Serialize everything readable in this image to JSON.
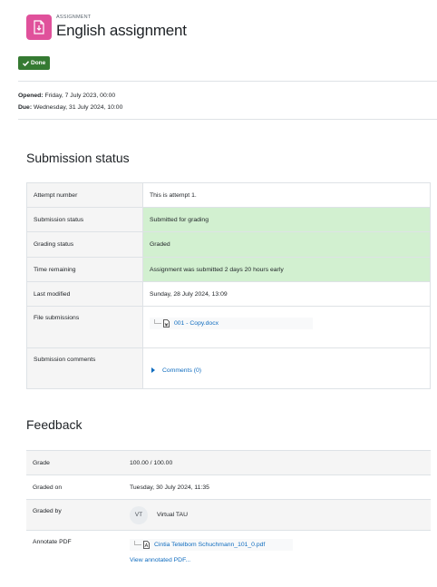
{
  "header": {
    "activity_type": "ASSIGNMENT",
    "title": "English assignment",
    "icon": "assignment-icon",
    "icon_color": "#e0519b"
  },
  "completion": {
    "label": "Done",
    "color": "#357a32"
  },
  "dates": {
    "opened_label": "Opened:",
    "opened_value": "Friday, 7 July 2023, 00:00",
    "due_label": "Due:",
    "due_value": "Wednesday, 31 July 2024, 10:00"
  },
  "submission": {
    "heading": "Submission status",
    "rows": [
      {
        "label": "Attempt number",
        "value": "This is attempt 1."
      },
      {
        "label": "Submission status",
        "value": "Submitted for grading"
      },
      {
        "label": "Grading status",
        "value": "Graded"
      },
      {
        "label": "Time remaining",
        "value": "Assignment was submitted 2 days 20 hours early"
      },
      {
        "label": "Last modified",
        "value": "Sunday, 28 July 2024, 13:09"
      },
      {
        "label": "File submissions",
        "value": "001 - Copy.docx"
      },
      {
        "label": "Submission comments",
        "value": "Comments (0)"
      }
    ],
    "success_color": "#d2f0d0"
  },
  "feedback": {
    "heading": "Feedback",
    "grade_label": "Grade",
    "grade_value": "100.00 / 100.00",
    "graded_on_label": "Graded on",
    "graded_on_value": "Tuesday, 30 July 2024, 11:35",
    "graded_by_label": "Graded by",
    "grader_initials": "VT",
    "grader_name": "Virtual TAU",
    "annotate_label": "Annotate PDF",
    "annotate_file": "Cintia Tetelbom Schuchmann_101_0.pdf",
    "annotate_link": "View annotated PDF..."
  },
  "link_color": "#0f6cbf"
}
